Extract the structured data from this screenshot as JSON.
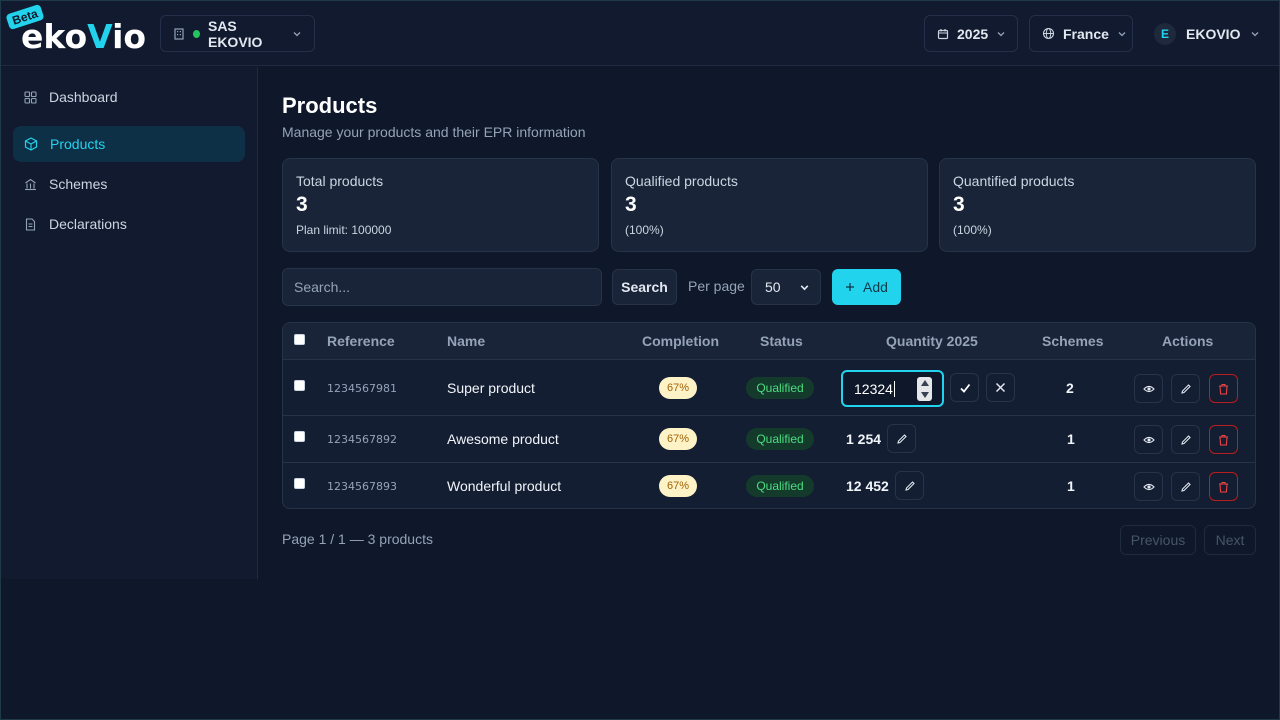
{
  "brand": {
    "logo_text_1": "eko",
    "logo_text_v": "V",
    "logo_text_2": "io",
    "beta": "Beta"
  },
  "header": {
    "org": "SAS EKOVIO",
    "year": "2025",
    "country": "France",
    "user_initial": "E",
    "user_name": "EKOVIO"
  },
  "sidebar": {
    "items": [
      {
        "label": "Dashboard",
        "icon": "dashboard-icon"
      },
      {
        "label": "Products",
        "icon": "box-icon",
        "active": true
      },
      {
        "label": "Schemes",
        "icon": "building-icon"
      },
      {
        "label": "Declarations",
        "icon": "document-icon"
      }
    ]
  },
  "page": {
    "title": "Products",
    "subtitle": "Manage your products and their EPR information"
  },
  "stats": [
    {
      "label": "Total products",
      "value": "3",
      "note": "Plan limit: 100000"
    },
    {
      "label": "Qualified products",
      "value": "3",
      "note": "(100%)"
    },
    {
      "label": "Quantified products",
      "value": "3",
      "note": "(100%)"
    }
  ],
  "toolbar": {
    "search_placeholder": "Search...",
    "search_button": "Search",
    "per_page_label": "Per page",
    "per_page_value": "50",
    "add_button": "Add"
  },
  "table": {
    "headers": {
      "reference": "Reference",
      "name": "Name",
      "completion": "Completion",
      "status": "Status",
      "quantity": "Quantity 2025",
      "schemes": "Schemes",
      "actions": "Actions"
    },
    "rows": [
      {
        "reference": "1234567981",
        "name": "Super product",
        "completion": "67%",
        "status": "Qualified",
        "quantity": "12324",
        "editing": true,
        "schemes": "2"
      },
      {
        "reference": "1234567892",
        "name": "Awesome product",
        "completion": "67%",
        "status": "Qualified",
        "quantity": "1 254",
        "editing": false,
        "schemes": "1"
      },
      {
        "reference": "1234567893",
        "name": "Wonderful product",
        "completion": "67%",
        "status": "Qualified",
        "quantity": "12 452",
        "editing": false,
        "schemes": "1"
      }
    ]
  },
  "pager": {
    "text": "Page 1 / 1 — 3 products",
    "previous": "Previous",
    "next": "Next"
  },
  "colors": {
    "accent": "#22d3ee",
    "background": "#0f172a",
    "qualified": "#4ade80",
    "completion_badge": "#fef3c7",
    "danger": "#ef4444"
  }
}
